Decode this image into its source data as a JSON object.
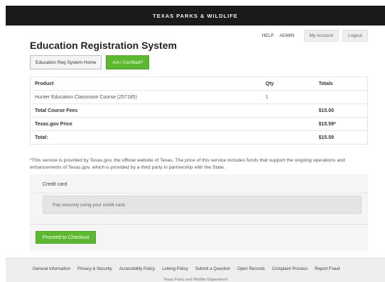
{
  "site": {
    "brand": "TEXAS PARKS & WILDLIFE"
  },
  "app": {
    "title": "Education Registration System"
  },
  "top_nav": {
    "help": "HELP",
    "admin": "ADMIN",
    "my_account": "My Account",
    "logout": "Logout"
  },
  "buttons": {
    "home": "Education Reg System Home",
    "certified": "Am I Certified?"
  },
  "table": {
    "headers": {
      "product": "Product",
      "qty": "Qty",
      "totals": "Totals"
    },
    "rows": [
      {
        "product": "Hunter Education Classroom Course (257185)",
        "qty": "1",
        "total": ""
      },
      {
        "product": "Total Course Fees",
        "qty": "",
        "total": "$15.00"
      },
      {
        "product": "Texas.gov Price",
        "qty": "",
        "total": "$15.59*"
      },
      {
        "product": "Total:",
        "qty": "",
        "total": "$15.59"
      }
    ]
  },
  "disclaimer": "*This service is provided by Texas.gov, the official website of Texas. The price of this service includes funds that support the ongoing operations and enhancements of Texas.gov, which is provided by a third party in partnership with the State.",
  "payment": {
    "title": "Credit card",
    "note": "Pay securely using your credit card.",
    "checkout": "Proceed to Checkout"
  },
  "footer": {
    "links": [
      "General Information",
      "Privacy & Security",
      "Accessibility Policy",
      "Linking Policy",
      "Submit a Question",
      "Open Records",
      "Complaint Process",
      "Report Fraud"
    ],
    "sub": "Texas Parks and Wildlife Department"
  },
  "colors": {
    "header_bg": "#1a1a1a",
    "accent_green": "#5cb82e",
    "panel_bg": "#f5f5f5",
    "footer_bg": "#eeeeee"
  }
}
